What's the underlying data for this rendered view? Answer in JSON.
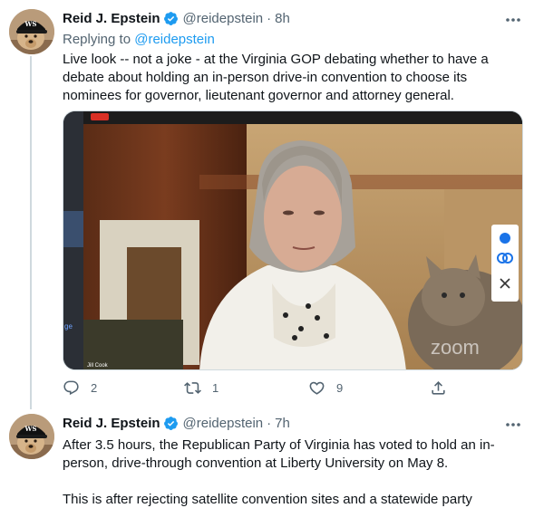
{
  "tweets": [
    {
      "name": "Reid J. Epstein",
      "handle": "@reidepstein",
      "dot": "·",
      "time": "8h",
      "replying_prefix": "Replying to ",
      "replying_to": "@reidepstein",
      "text": "Live look -- not a joke - at the Virginia GOP debating whether to have a debate about holding an in-person drive-in convention to choose its nominees for governor, lieutenant governor and attorney general.",
      "media": {
        "participant_label": "Jill Cook",
        "watermark": "zoom",
        "sidebar_fragment": "ge"
      },
      "actions": {
        "reply_count": "2",
        "retweet_count": "1",
        "like_count": "9"
      }
    },
    {
      "name": "Reid J. Epstein",
      "handle": "@reidepstein",
      "dot": "·",
      "time": "7h",
      "paragraphs": [
        "After 3.5 hours, the Republican Party of Virginia has voted to hold an in-person, drive-through convention at Liberty University on May 8.",
        "This is after rejecting satellite convention sites and a statewide party canvass."
      ]
    }
  ],
  "colors": {
    "text": "#0f1419",
    "secondary": "#536471",
    "accent": "#1d9bf0",
    "verified": "#1d9bf0",
    "zoom_ui": "#1a73e8"
  },
  "icons": {
    "more": "more-icon",
    "verified": "verified-badge-icon",
    "reply": "reply-icon",
    "retweet": "retweet-icon",
    "like": "like-icon",
    "share": "share-icon"
  }
}
